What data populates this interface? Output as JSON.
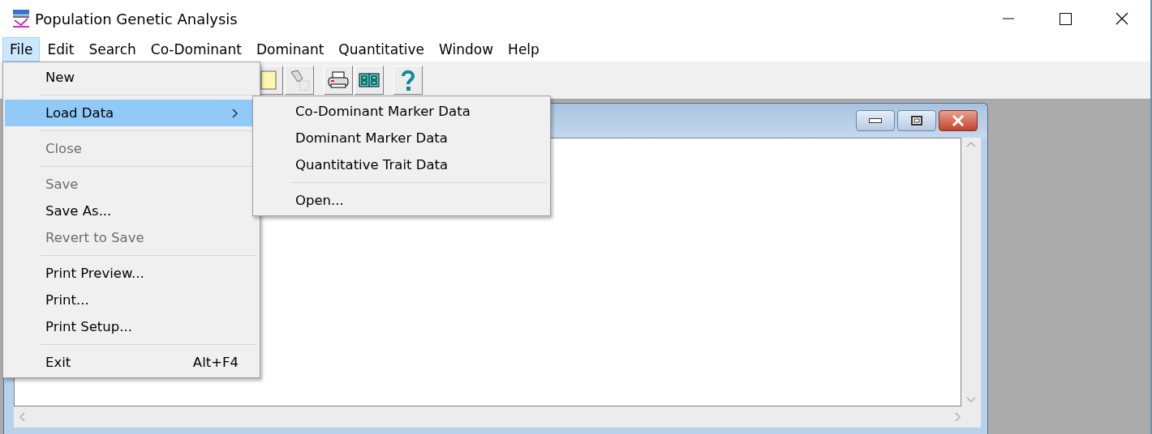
{
  "window": {
    "title": "Population Genetic Analysis"
  },
  "menu_bar": [
    {
      "label": "File",
      "selected": true
    },
    {
      "label": "Edit",
      "selected": false
    },
    {
      "label": "Search",
      "selected": false
    },
    {
      "label": "Co-Dominant",
      "selected": false
    },
    {
      "label": "Dominant",
      "selected": false
    },
    {
      "label": "Quantitative",
      "selected": false
    },
    {
      "label": "Window",
      "selected": false
    },
    {
      "label": "Help",
      "selected": false
    }
  ],
  "toolbar": [
    {
      "kind": "document"
    },
    {
      "kind": "flashlight"
    },
    {
      "kind": "gap"
    },
    {
      "kind": "printer"
    },
    {
      "kind": "book"
    },
    {
      "kind": "gap"
    },
    {
      "kind": "help"
    }
  ],
  "file_menu": [
    {
      "kind": "item",
      "label": "New",
      "disabled": false,
      "selected": false
    },
    {
      "kind": "separator"
    },
    {
      "kind": "submenu",
      "label": "Load Data",
      "disabled": false,
      "selected": true
    },
    {
      "kind": "separator"
    },
    {
      "kind": "item",
      "label": "Close",
      "disabled": true,
      "selected": false
    },
    {
      "kind": "separator"
    },
    {
      "kind": "item",
      "label": "Save",
      "disabled": true,
      "selected": false
    },
    {
      "kind": "item",
      "label": "Save As...",
      "disabled": false,
      "selected": false
    },
    {
      "kind": "item",
      "label": "Revert to Save",
      "disabled": true,
      "selected": false
    },
    {
      "kind": "separator"
    },
    {
      "kind": "item",
      "label": "Print Preview...",
      "disabled": false,
      "selected": false
    },
    {
      "kind": "item",
      "label": "Print...",
      "disabled": false,
      "selected": false
    },
    {
      "kind": "item",
      "label": "Print Setup...",
      "disabled": false,
      "selected": false
    },
    {
      "kind": "separator"
    },
    {
      "kind": "item",
      "label": "Exit",
      "shortcut": "Alt+F4",
      "disabled": false,
      "selected": false
    }
  ],
  "load_data_submenu": [
    {
      "kind": "item",
      "label": "Co-Dominant Marker Data",
      "disabled": false,
      "selected": false
    },
    {
      "kind": "item",
      "label": "Dominant Marker Data",
      "disabled": false,
      "selected": false
    },
    {
      "kind": "item",
      "label": "Quantitative Trait Data",
      "disabled": false,
      "selected": false
    },
    {
      "kind": "separator"
    },
    {
      "kind": "item",
      "label": "Open...",
      "disabled": false,
      "selected": false
    }
  ]
}
